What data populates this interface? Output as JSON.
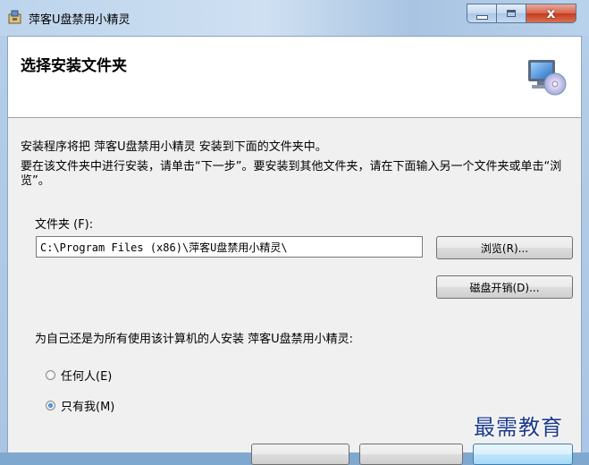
{
  "window": {
    "title": "萍客U盘禁用小精灵",
    "close_label": "x"
  },
  "banner": {
    "title": "选择安装文件夹"
  },
  "content": {
    "intro_line1": "安装程序将把 萍客U盘禁用小精灵 安装到下面的文件夹中。",
    "intro_line2": "要在该文件夹中进行安装，请单击“下一步”。要安装到其他文件夹，请在下面输入另一个文件夹或单击“浏览”。",
    "folder_label": "文件夹 (F):",
    "folder_path": "C:\\Program Files (x86)\\萍客U盘禁用小精灵\\",
    "browse_label": "浏览(R)...",
    "disk_cost_label": "磁盘开销(D)...",
    "install_question": "为自己还是为所有使用该计算机的人安装 萍客U盘禁用小精灵:",
    "options": [
      {
        "label": "任何人(E)",
        "selected": false
      },
      {
        "label": "只有我(M)",
        "selected": true
      }
    ]
  },
  "watermark": "最需教育",
  "colors": {
    "title_bar": "#bcd4ec",
    "close_button": "#c43c1e",
    "watermark": "#1c3b8c"
  }
}
